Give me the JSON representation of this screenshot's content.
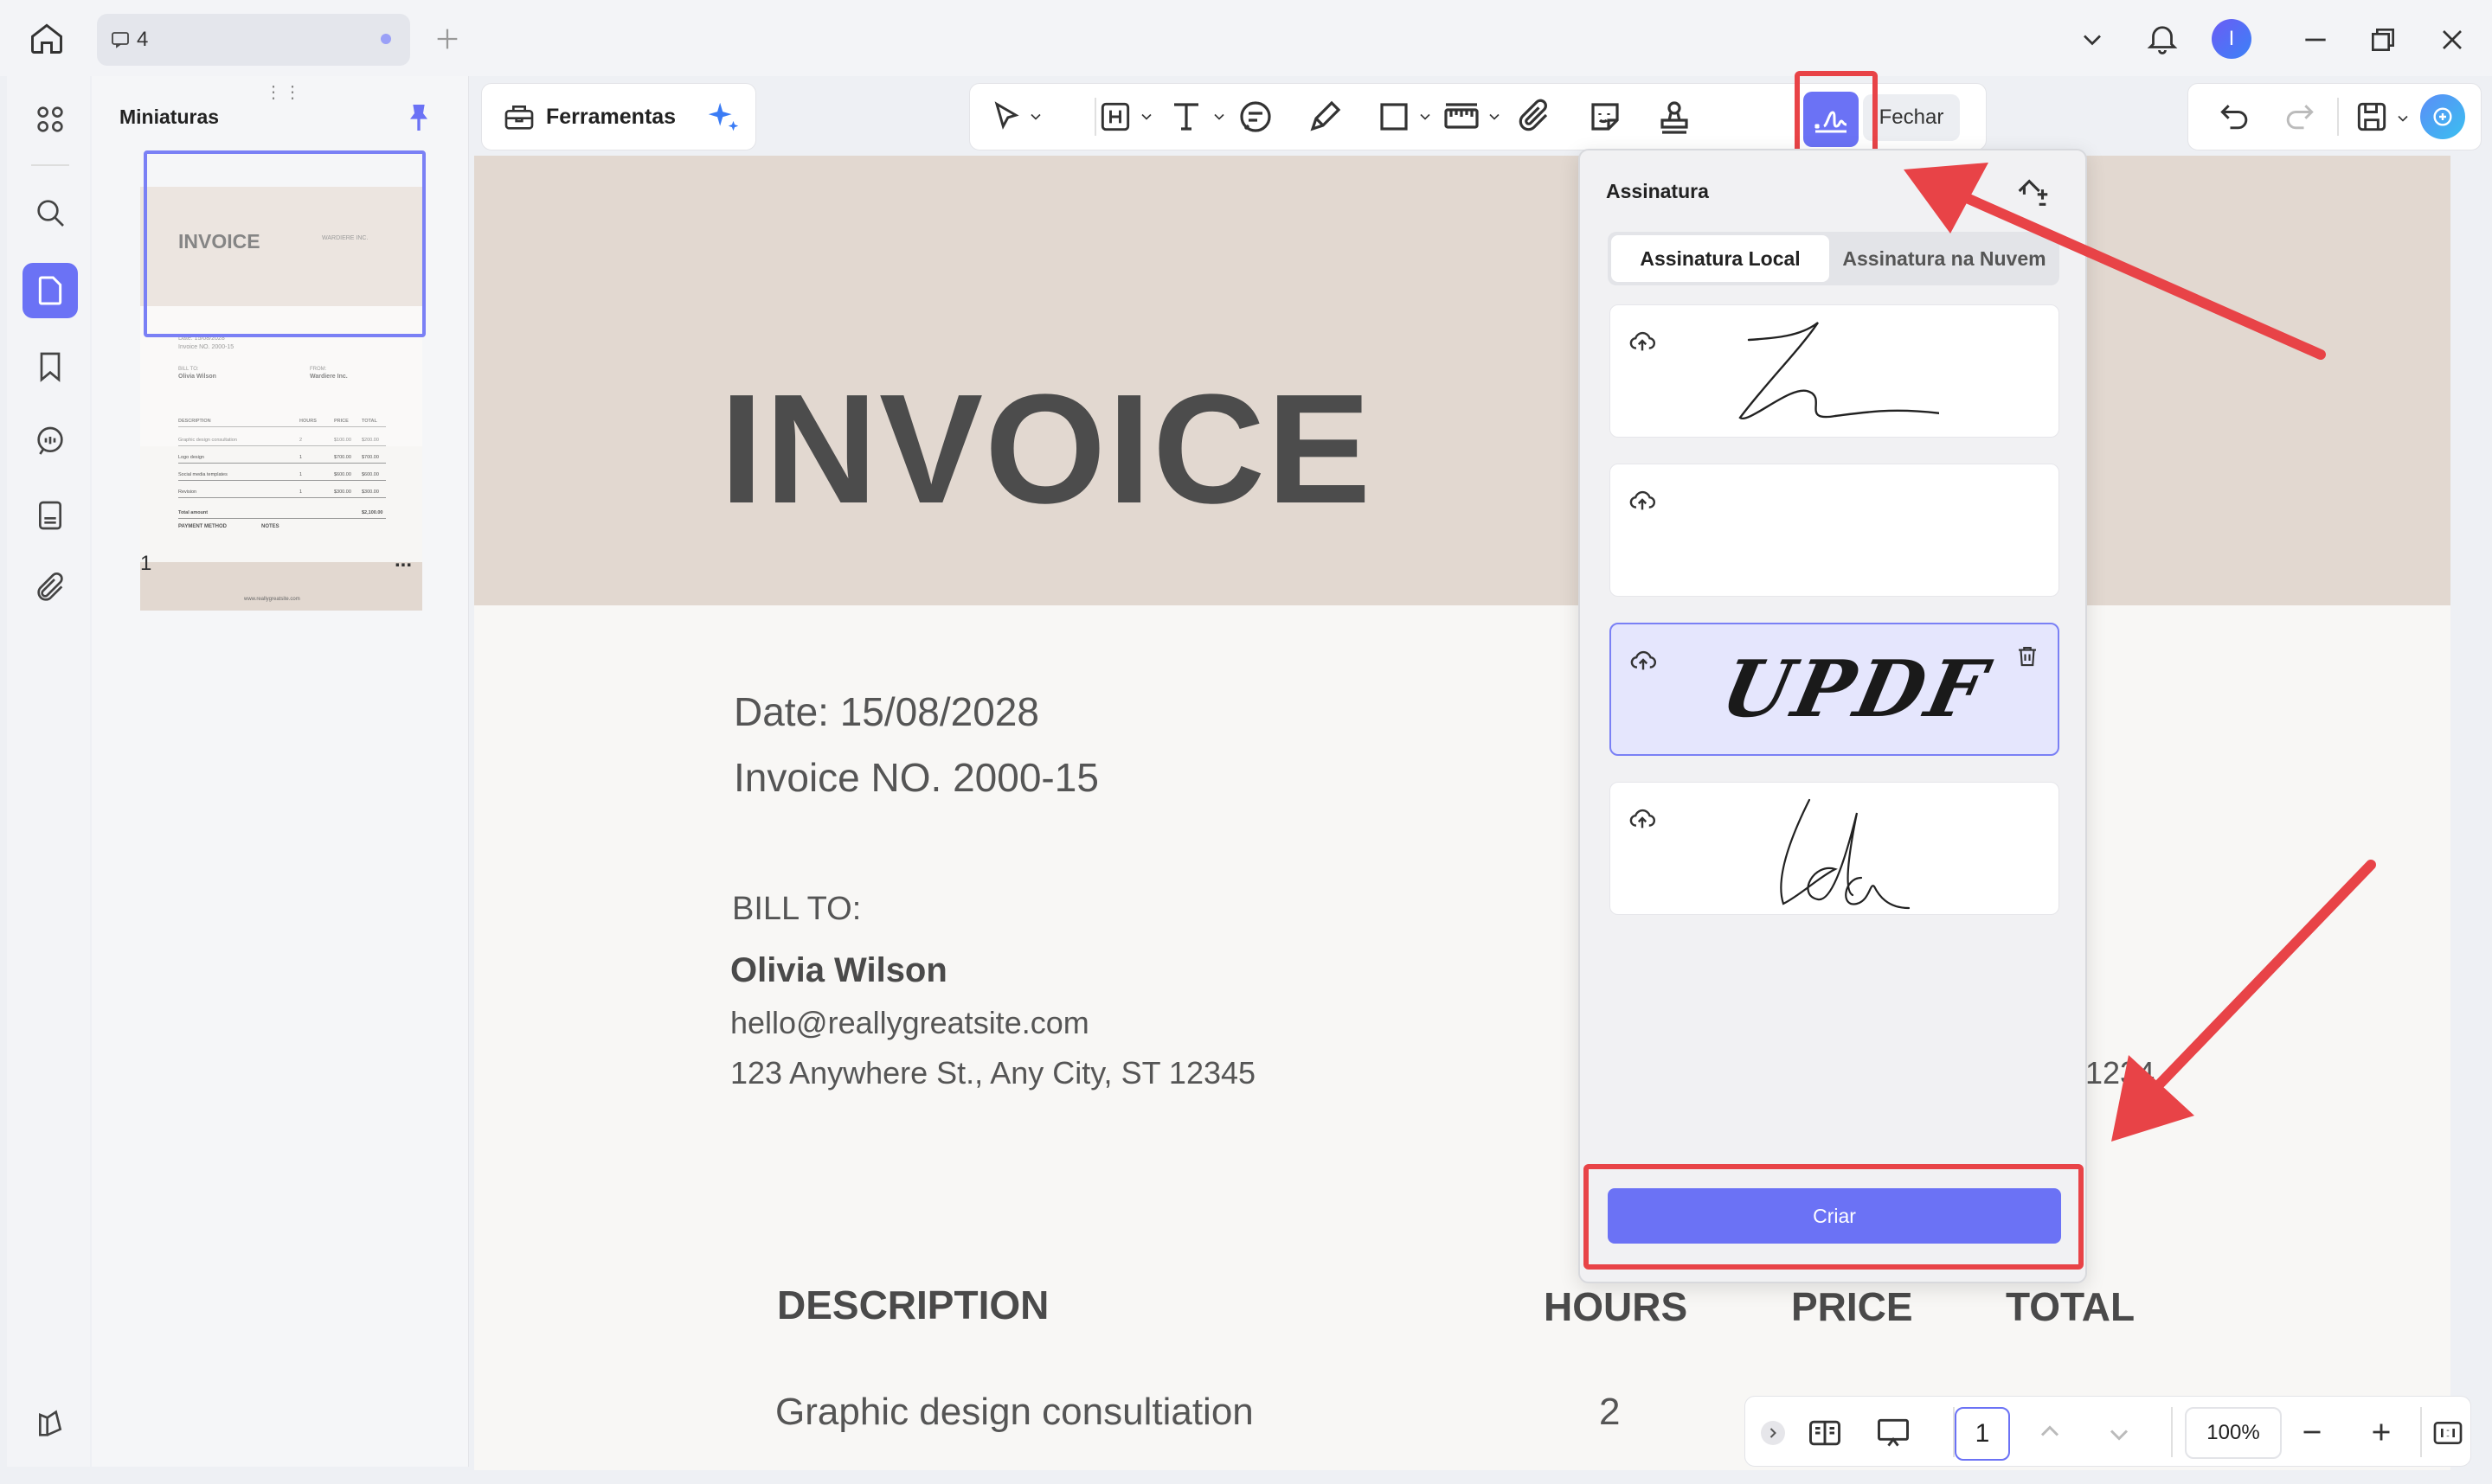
{
  "app": {
    "tab_count": "4",
    "user_initial": "I"
  },
  "thumbnails": {
    "title": "Miniaturas",
    "page_number": "1",
    "more": "...",
    "mini": {
      "title": "INVOICE",
      "company": "WARDIERE INC.",
      "date": "Date: 15/08/2028",
      "invoice_no": "Invoice NO. 2000-15",
      "bill_to": "BILL TO:",
      "name": "Olivia Wilson",
      "from": "FROM:",
      "from_name": "Wardiere Inc.",
      "cols": [
        "DESCRIPTION",
        "HOURS",
        "PRICE",
        "TOTAL"
      ],
      "rows": [
        [
          "Graphic design consultation",
          "2",
          "$100.00",
          "$200.00"
        ],
        [
          "Logo design",
          "1",
          "$700.00",
          "$700.00"
        ],
        [
          "Social media templates",
          "1",
          "$600.00",
          "$600.00"
        ],
        [
          "Revision",
          "1",
          "$300.00",
          "$300.00"
        ]
      ],
      "total_label": "Total amount",
      "total_value": "$2,100.00",
      "payment": "PAYMENT METHOD",
      "notes": "NOTES",
      "website": "www.reallygreatsite.com"
    }
  },
  "toolbar": {
    "tools_label": "Ferramentas",
    "close_label": "Fechar",
    "accent": "#6b72f5"
  },
  "document": {
    "title": "INVOICE",
    "date": "Date: 15/08/2028",
    "invoice_no": "Invoice NO. 2000-15",
    "bill_to": "BILL TO:",
    "client_name": "Olivia  Wilson",
    "client_email": "hello@reallygreatsite.com",
    "client_address": "123 Anywhere St., Any City, ST 12345",
    "partial_text": "1234",
    "col_description": "DESCRIPTION",
    "col_hours": "HOURS",
    "col_price": "PRICE",
    "col_total": "TOTAL",
    "row1_description": "Graphic design consultiation",
    "row1_hours": "2"
  },
  "signature_panel": {
    "title": "Assinatura",
    "tab_local": "Assinatura Local",
    "tab_cloud": "Assinatura na Nuvem",
    "signatures": [
      "signature-1",
      "signature-2",
      "signature-updf",
      "signature-lda"
    ],
    "signature_updf_text": "UPDF",
    "create_button": "Criar"
  },
  "navigation": {
    "page": "1",
    "zoom": "100%"
  }
}
